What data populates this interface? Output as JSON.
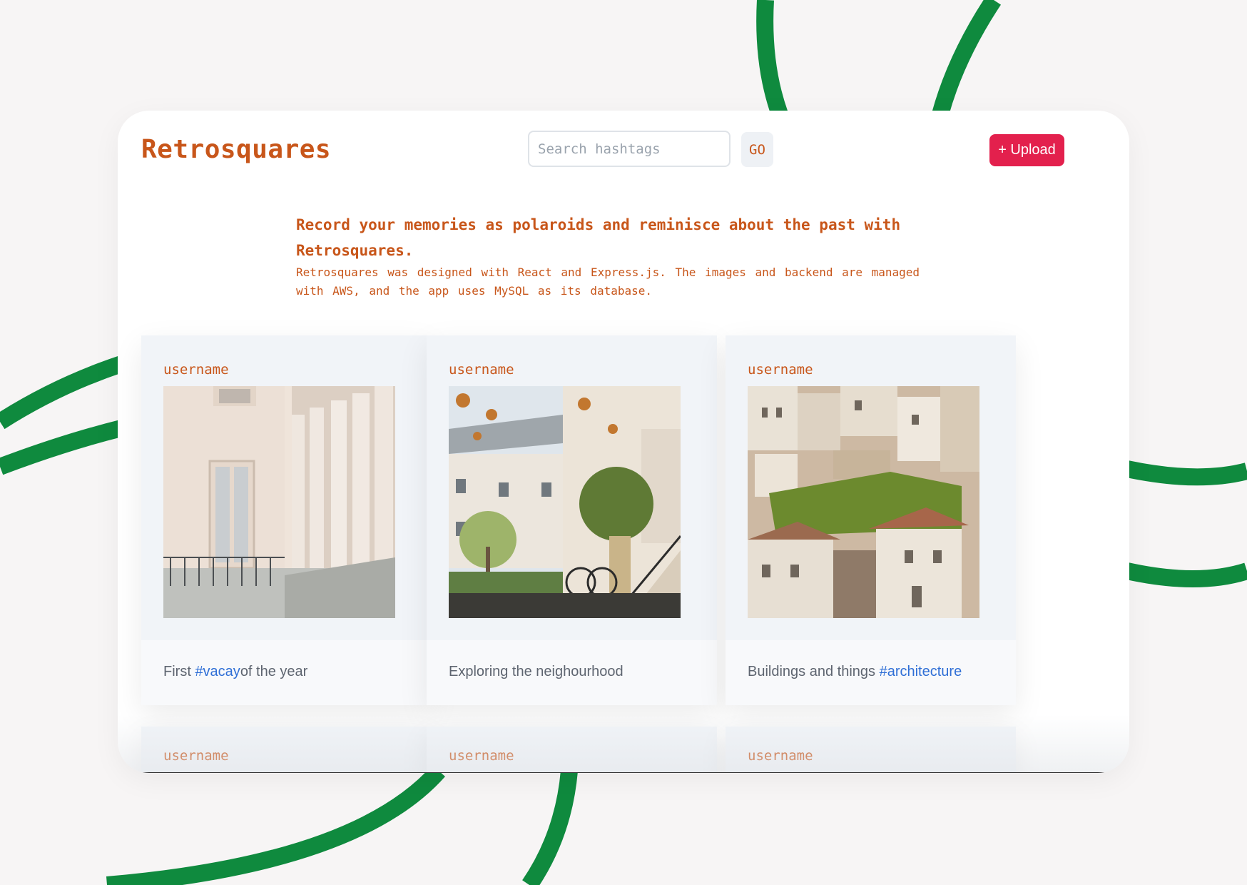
{
  "colors": {
    "accent": "#c8561a",
    "upload_button": "#e3204d",
    "hashtag": "#2f6fd6",
    "decoration_green": "#0f8a3e",
    "card_bg": "#f1f4f8"
  },
  "header": {
    "brand": "Retrosquares",
    "search_placeholder": "Search hashtags",
    "go_label": "GO",
    "upload_label": "+ Upload"
  },
  "intro": {
    "headline": "Record your memories as polaroids and reminisce about the past with Retrosquares.",
    "description": "Retrosquares was designed with React and Express.js. The images and backend are managed with AWS, and the app uses MySQL as its database."
  },
  "posts": [
    {
      "username": "username",
      "caption_before": "First ",
      "hashtag": "#vacay",
      "caption_after": "of the year",
      "image": "white building colonnade photo"
    },
    {
      "username": "username",
      "caption_before": "Exploring the neighourhood",
      "hashtag": "",
      "caption_after": "",
      "image": "courtyard with bicycle and potted tree photo"
    },
    {
      "username": "username",
      "caption_before": "Buildings and things ",
      "hashtag": "#architecture",
      "caption_after": "",
      "image": "hillside town houses photo"
    },
    {
      "username": "username"
    },
    {
      "username": "username"
    },
    {
      "username": "username"
    }
  ]
}
